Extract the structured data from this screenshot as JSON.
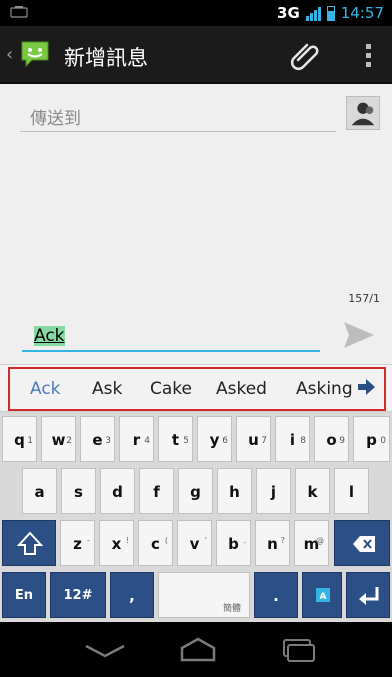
{
  "status_bar": {
    "network": "3G",
    "time": "14:57"
  },
  "action_bar": {
    "title": "新增訊息"
  },
  "compose": {
    "to_placeholder": "傳送到",
    "char_count": "157/1",
    "message_value": "Ack"
  },
  "suggestions": [
    "Ack",
    "Ask",
    "Cake",
    "Asked",
    "Asking"
  ],
  "keyboard": {
    "row1": [
      {
        "k": "q",
        "n": "1"
      },
      {
        "k": "w",
        "n": "2"
      },
      {
        "k": "e",
        "n": "3"
      },
      {
        "k": "r",
        "n": "4"
      },
      {
        "k": "t",
        "n": "5"
      },
      {
        "k": "y",
        "n": "6"
      },
      {
        "k": "u",
        "n": "7"
      },
      {
        "k": "i",
        "n": "8"
      },
      {
        "k": "o",
        "n": "9"
      },
      {
        "k": "p",
        "n": "0"
      }
    ],
    "row2": [
      "a",
      "s",
      "d",
      "f",
      "g",
      "h",
      "j",
      "k",
      "l"
    ],
    "row3": [
      {
        "k": "z",
        "s": "-"
      },
      {
        "k": "x",
        "s": "!"
      },
      {
        "k": "c",
        "s": "("
      },
      {
        "k": "v",
        "s": "'"
      },
      {
        "k": "b",
        "s": "."
      },
      {
        "k": "n",
        "s": "?"
      },
      {
        "k": "m",
        "s": "@"
      }
    ],
    "lang_key": "En",
    "symbols_key": "12#",
    "comma_key": ",",
    "space_hint": "簡體",
    "period_key": "."
  },
  "colors": {
    "accent": "#33b5e5",
    "keyboard_dark": "#2c4f85",
    "highlight_frame": "#d12a2a"
  }
}
